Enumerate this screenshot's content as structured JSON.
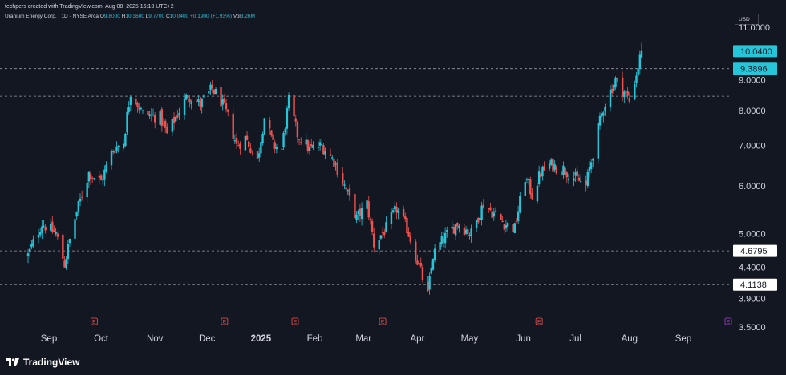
{
  "header": {
    "attribution": "techpers created with TradingView.com, Aug 08, 2025 16:13 UTC+2",
    "symbol_name": "Uranium Energy Corp. · 1D · NYSE Arca",
    "open_label": "O",
    "open": "9.8000",
    "high_label": "H",
    "high": "10.3600",
    "low_label": "L",
    "low": "9.7700",
    "close_label": "C",
    "close": "10.0400",
    "change": "+0.1900 (+1.93%)",
    "volume_label": "Vol",
    "volume": "3.26M"
  },
  "currency": "USD",
  "footer": {
    "brand": "TradingView"
  },
  "colors": {
    "up": "#26c6da",
    "down": "#ef5350",
    "background": "#131722",
    "price_tag": "#26c6da",
    "level_line": "#9598a1"
  },
  "chart_data": {
    "type": "candlestick",
    "y_axis_scale": "log",
    "y_ticks": [
      "11.0000",
      "9.0000",
      "8.0000",
      "7.0000",
      "6.0000",
      "5.0000",
      "4.4000",
      "3.9000",
      "3.5000"
    ],
    "x_ticks": [
      "Sep",
      "Oct",
      "Nov",
      "Dec",
      "2025",
      "Feb",
      "Mar",
      "Apr",
      "May",
      "Jun",
      "Jul",
      "Aug",
      "Sep"
    ],
    "earnings_markers": [
      "E",
      "E",
      "E",
      "E",
      "E",
      "E"
    ],
    "price_labels": [
      {
        "label": "10.0400",
        "value": 10.04,
        "style": "last-price"
      },
      {
        "label": "9.3896",
        "value": 9.3896,
        "style": "level"
      },
      {
        "label": "4.6795",
        "value": 4.6795,
        "style": "level"
      },
      {
        "label": "4.1138",
        "value": 4.1138,
        "style": "level"
      }
    ],
    "horizontal_levels": [
      9.3896,
      8.45,
      4.6795,
      4.1138
    ],
    "anchors": [
      [
        "2024-08-20",
        4.6
      ],
      [
        "2024-08-28",
        5.2
      ],
      [
        "2024-09-05",
        5.0
      ],
      [
        "2024-09-10",
        4.45
      ],
      [
        "2024-09-16",
        5.3
      ],
      [
        "2024-09-24",
        6.3
      ],
      [
        "2024-10-01",
        6.1
      ],
      [
        "2024-10-08",
        6.9
      ],
      [
        "2024-10-14",
        7.1
      ],
      [
        "2024-10-18",
        8.6
      ],
      [
        "2024-10-25",
        7.9
      ],
      [
        "2024-11-04",
        7.8
      ],
      [
        "2024-11-08",
        7.3
      ],
      [
        "2024-11-15",
        8.0
      ],
      [
        "2024-11-20",
        8.5
      ],
      [
        "2024-11-27",
        8.2
      ],
      [
        "2024-12-04",
        8.7
      ],
      [
        "2024-12-09",
        8.3
      ],
      [
        "2024-12-13",
        7.8
      ],
      [
        "2024-12-18",
        7.0
      ],
      [
        "2024-12-23",
        7.2
      ],
      [
        "2024-12-30",
        6.6
      ],
      [
        "2025-01-03",
        7.8
      ],
      [
        "2025-01-08",
        7.0
      ],
      [
        "2025-01-13",
        6.9
      ],
      [
        "2025-01-17",
        8.3
      ],
      [
        "2025-01-22",
        7.3
      ],
      [
        "2025-01-29",
        6.9
      ],
      [
        "2025-02-05",
        7.0
      ],
      [
        "2025-02-12",
        6.6
      ],
      [
        "2025-02-19",
        5.9
      ],
      [
        "2025-02-25",
        5.3
      ],
      [
        "2025-03-03",
        5.6
      ],
      [
        "2025-03-07",
        4.8
      ],
      [
        "2025-03-14",
        5.1
      ],
      [
        "2025-03-20",
        5.5
      ],
      [
        "2025-03-26",
        5.1
      ],
      [
        "2025-04-01",
        4.5
      ],
      [
        "2025-04-07",
        3.95
      ],
      [
        "2025-04-10",
        4.6
      ],
      [
        "2025-04-16",
        4.9
      ],
      [
        "2025-04-24",
        5.2
      ],
      [
        "2025-05-02",
        5.0
      ],
      [
        "2025-05-09",
        5.6
      ],
      [
        "2025-05-15",
        5.4
      ],
      [
        "2025-05-21",
        5.2
      ],
      [
        "2025-05-27",
        5.1
      ],
      [
        "2025-06-02",
        6.2
      ],
      [
        "2025-06-06",
        5.8
      ],
      [
        "2025-06-11",
        6.3
      ],
      [
        "2025-06-16",
        6.5
      ],
      [
        "2025-06-24",
        6.4
      ],
      [
        "2025-06-30",
        6.2
      ],
      [
        "2025-07-07",
        6.0
      ],
      [
        "2025-07-11",
        6.8
      ],
      [
        "2025-07-17",
        8.1
      ],
      [
        "2025-07-24",
        9.0
      ],
      [
        "2025-07-29",
        8.6
      ],
      [
        "2025-08-01",
        8.3
      ],
      [
        "2025-08-05",
        9.2
      ],
      [
        "2025-08-08",
        10.04
      ]
    ]
  }
}
